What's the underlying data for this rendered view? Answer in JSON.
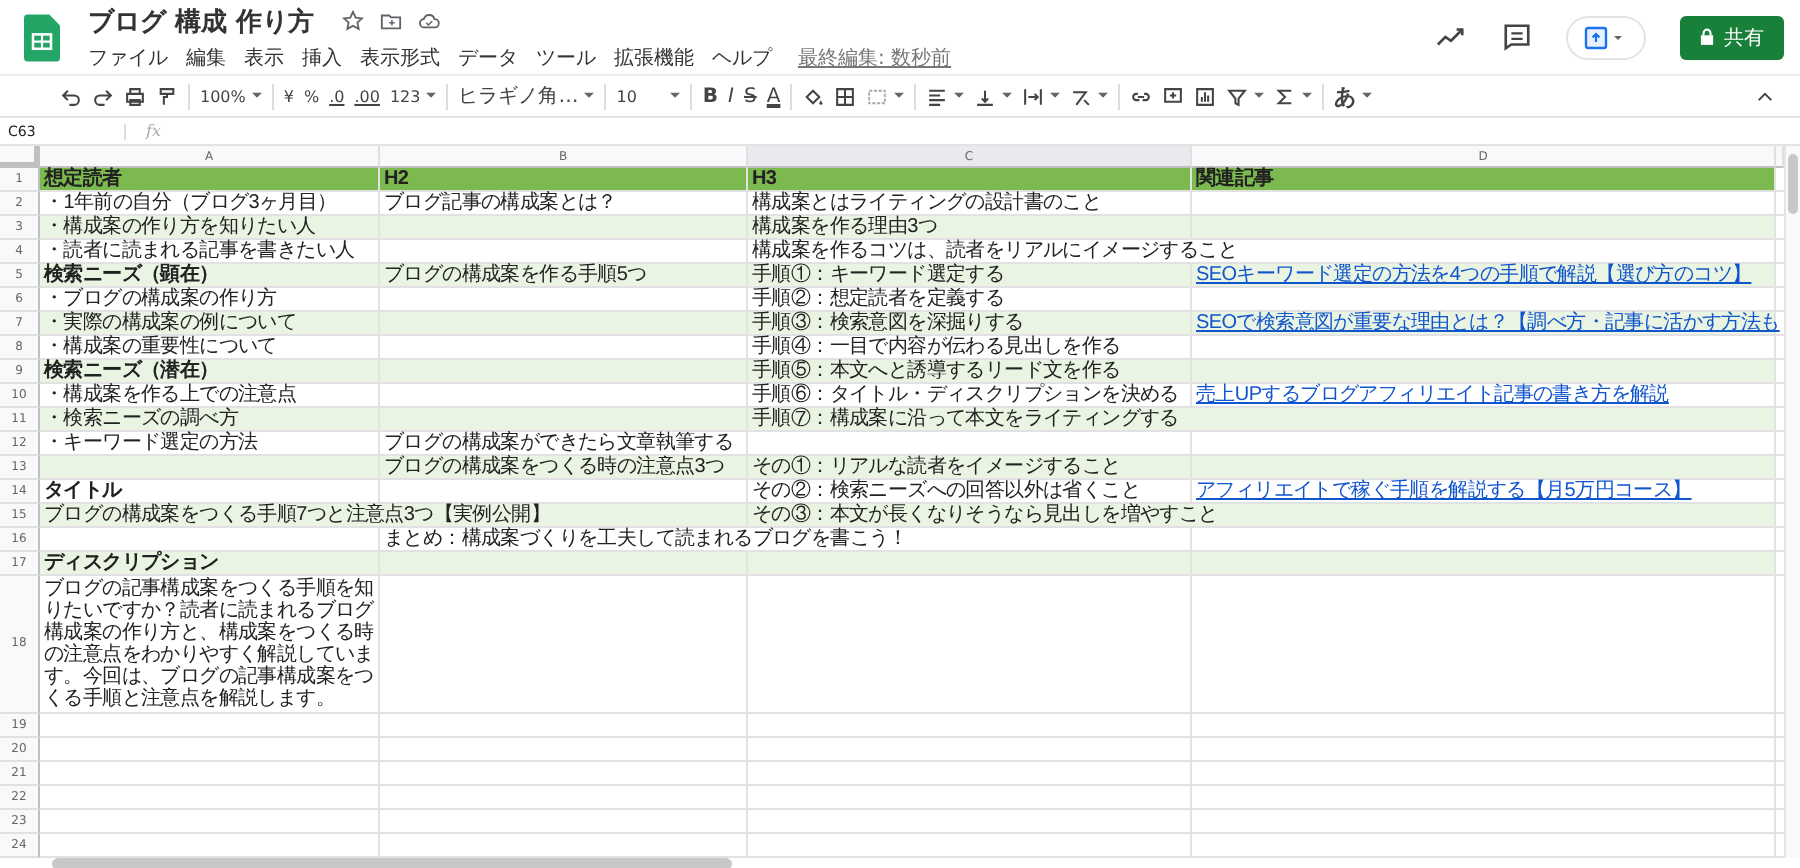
{
  "document": {
    "title": "ブログ 構成 作り方",
    "last_edit": "最終編集: 数秒前"
  },
  "menu": [
    "ファイル",
    "編集",
    "表示",
    "挿入",
    "表示形式",
    "データ",
    "ツール",
    "拡張機能",
    "ヘルプ"
  ],
  "share_button": "共有",
  "toolbar": {
    "zoom": "100%",
    "currency": "¥",
    "percent": "%",
    "decrease_decimals": ".0",
    "increase_decimals": ".00",
    "number_format": "123",
    "font": "ヒラギノ角…",
    "font_size": "10",
    "bold": "B",
    "italic": "I",
    "strikethrough": "S",
    "text_color": "A",
    "input_tools": "あ"
  },
  "formula_bar": {
    "cell_ref": "C63",
    "fx": "fx"
  },
  "columns": [
    "A",
    "B",
    "C",
    "D"
  ],
  "rows": [
    {
      "number": "1",
      "kind": "header",
      "cells": [
        {
          "text": "想定読者",
          "bold": true
        },
        {
          "text": "H2",
          "bold": true
        },
        {
          "text": "H3",
          "bold": true
        },
        {
          "text": "関連記事",
          "bold": true
        }
      ]
    },
    {
      "number": "2",
      "kind": "white",
      "cells": [
        {
          "text": "・1年前の自分（ブログ3ヶ月目）"
        },
        {
          "text": "ブログ記事の構成案とは？"
        },
        {
          "text": "構成案とはライティングの設計書のこと"
        },
        {}
      ]
    },
    {
      "number": "3",
      "kind": "band",
      "cells": [
        {
          "text": "・構成案の作り方を知りたい人"
        },
        {},
        {
          "text": "構成案を作る理由3つ"
        },
        {}
      ]
    },
    {
      "number": "4",
      "kind": "white",
      "cells": [
        {
          "text": "・読者に読まれる記事を書きたい人"
        },
        {},
        {
          "text": "構成案を作るコツは、読者をリアルにイメージすること"
        },
        {}
      ]
    },
    {
      "number": "5",
      "kind": "band",
      "cells": [
        {
          "text": "検索ニーズ（顕在）",
          "bold": true
        },
        {
          "text": "ブログの構成案を作る手順5つ"
        },
        {
          "text": "手順①：キーワード選定する"
        },
        {
          "text": "SEOキーワード選定の方法を4つの手順で解説【選び方のコツ】",
          "link": true
        }
      ]
    },
    {
      "number": "6",
      "kind": "white",
      "cells": [
        {
          "text": "・ブログの構成案の作り方"
        },
        {},
        {
          "text": "手順②：想定読者を定義する"
        },
        {}
      ]
    },
    {
      "number": "7",
      "kind": "band",
      "cells": [
        {
          "text": "・実際の構成案の例について"
        },
        {},
        {
          "text": "手順③：検索意図を深掘りする"
        },
        {
          "text": "SEOで検索意図が重要な理由とは？【調べ方・記事に活かす方法も",
          "link": true
        }
      ]
    },
    {
      "number": "8",
      "kind": "white",
      "cells": [
        {
          "text": "・構成案の重要性について"
        },
        {},
        {
          "text": "手順④：一目で内容が伝わる見出しを作る"
        },
        {}
      ]
    },
    {
      "number": "9",
      "kind": "band",
      "cells": [
        {
          "text": "検索ニーズ（潜在）",
          "bold": true
        },
        {},
        {
          "text": "手順⑤：本文へと誘導するリード文を作る"
        },
        {}
      ]
    },
    {
      "number": "10",
      "kind": "white",
      "cells": [
        {
          "text": "・構成案を作る上での注意点"
        },
        {},
        {
          "text": "手順⑥：タイトル・ディスクリプションを決める"
        },
        {
          "text": "売上UPするブログアフィリエイト記事の書き方を解説",
          "link": true
        }
      ]
    },
    {
      "number": "11",
      "kind": "band",
      "cells": [
        {
          "text": "・検索ニーズの調べ方"
        },
        {},
        {
          "text": "手順⑦：構成案に沿って本文をライティングする"
        },
        {}
      ]
    },
    {
      "number": "12",
      "kind": "white",
      "cells": [
        {
          "text": "・キーワード選定の方法"
        },
        {
          "text": "ブログの構成案ができたら文章執筆する"
        },
        {},
        {}
      ]
    },
    {
      "number": "13",
      "kind": "band",
      "cells": [
        {},
        {
          "text": "ブログの構成案をつくる時の注意点3つ"
        },
        {
          "text": "その①：リアルな読者をイメージすること"
        },
        {}
      ]
    },
    {
      "number": "14",
      "kind": "white",
      "cells": [
        {
          "text": "タイトル",
          "bold": true
        },
        {},
        {
          "text": "その②：検索ニーズへの回答以外は省くこと"
        },
        {
          "text": "アフィリエイトで稼ぐ手順を解説する【月5万円コース】",
          "link": true
        }
      ]
    },
    {
      "number": "15",
      "kind": "band",
      "cells": [
        {
          "text": "ブログの構成案をつくる手順7つと注意点3つ【実例公開】"
        },
        {},
        {
          "text": "その③：本文が長くなりそうなら見出しを増やすこと"
        },
        {}
      ]
    },
    {
      "number": "16",
      "kind": "white",
      "cells": [
        {},
        {
          "text": "まとめ：構成案づくりを工夫して読まれるブログを書こう！"
        },
        {},
        {}
      ]
    },
    {
      "number": "17",
      "kind": "band",
      "cells": [
        {
          "text": "ディスクリプション",
          "bold": true
        },
        {},
        {},
        {}
      ]
    },
    {
      "number": "18",
      "kind": "white",
      "cells": [
        {
          "text": "ブログの記事構成案をつくる手順を知りたいですか？読者に読まれるブログ構成案の作り方と、構成案をつくる時の注意点をわかりやすく解説しています。今回は、ブログの記事構成案をつくる手順と注意点を解説します。",
          "wrap": true
        },
        {},
        {},
        {}
      ]
    },
    {
      "number": "19",
      "kind": "plain",
      "cells": [
        {},
        {},
        {},
        {}
      ]
    },
    {
      "number": "20",
      "kind": "plain",
      "cells": [
        {},
        {},
        {},
        {}
      ]
    },
    {
      "number": "21",
      "kind": "plain",
      "cells": [
        {},
        {},
        {},
        {}
      ]
    },
    {
      "number": "22",
      "kind": "plain",
      "cells": [
        {},
        {},
        {},
        {}
      ]
    },
    {
      "number": "23",
      "kind": "plain",
      "cells": [
        {},
        {},
        {},
        {}
      ]
    },
    {
      "number": "24",
      "kind": "plain",
      "cells": [
        {},
        {},
        {},
        {}
      ]
    }
  ]
}
